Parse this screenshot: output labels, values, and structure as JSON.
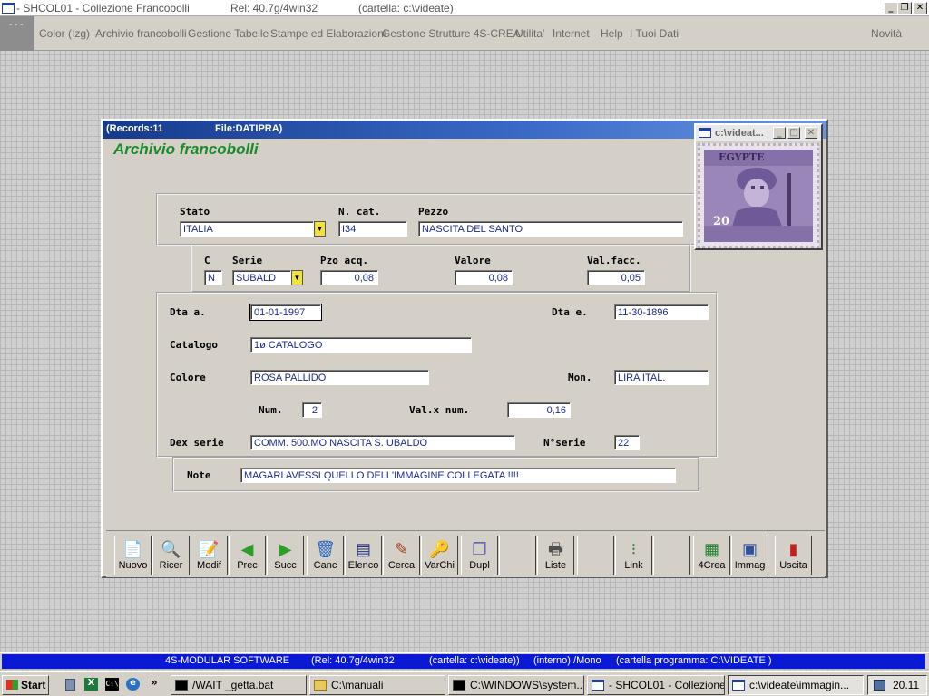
{
  "window": {
    "title": "- SHCOL01 - Collezione Francobolli",
    "rel": "Rel: 40.7g/4win32",
    "folder": "(cartella: c:\\videate)"
  },
  "menu": {
    "logo": "- - -",
    "items": [
      "Color (Izg)",
      "Archivio francobolli",
      "Gestione Tabelle",
      "Stampe ed Elaborazioni",
      "Gestione Strutture 4S-CREA",
      "Utilita'",
      "Internet",
      "Help",
      "I Tuoi Dati"
    ],
    "right": "Novità"
  },
  "form": {
    "records": "(Records:11",
    "file": "File:DATIPRA)",
    "app_title": "Archivio francobolli",
    "labels": {
      "stato": "Stato",
      "ncat": "N. cat.",
      "pezzo": "Pezzo",
      "c": "C",
      "serie": "Serie",
      "pzo_acq": "Pzo acq.",
      "valore": "Valore",
      "val_facc": "Val.facc.",
      "dta_a": "Dta a.",
      "dta_e": "Dta e.",
      "catalogo": "Catalogo",
      "colore": "Colore",
      "mon": "Mon.",
      "num": "Num.",
      "val_x_num": "Val.x num.",
      "dex_serie": "Dex serie",
      "n_serie": "N°serie",
      "note": "Note"
    },
    "values": {
      "stato": "ITALIA",
      "ncat": "I34",
      "pezzo": "NASCITA DEL SANTO",
      "c": "N",
      "serie": "SUBALD",
      "pzo_acq": "0,08",
      "valore": "0,08",
      "val_facc": "0,05",
      "dta_a": "01-01-1997",
      "dta_e": "11-30-1896",
      "catalogo": "1ø CATALOGO",
      "colore": "ROSA PALLIDO",
      "mon": "LIRA ITAL.",
      "num": "2",
      "val_x_num": "0,16",
      "dex_serie": "COMM. 500.MO NASCITA S. UBALDO",
      "n_serie": "22",
      "note": "MAGARI AVESSI QUELLO DELL'IMMAGINE COLLEGATA !!!!"
    }
  },
  "toolbar": {
    "buttons": [
      {
        "label": "Nuovo",
        "icon": "new-doc-icon",
        "glyph": "📄",
        "color": "#2a8a2a"
      },
      {
        "label": "Ricer",
        "icon": "magnifier-icon",
        "glyph": "🔍",
        "color": "#3050a0"
      },
      {
        "label": "Modif",
        "icon": "edit-doc-icon",
        "glyph": "📝",
        "color": "#3050a0"
      },
      {
        "label": "Prec",
        "icon": "arrow-left-icon",
        "glyph": "◀",
        "color": "#2aa02a"
      },
      {
        "label": "Succ",
        "icon": "arrow-right-icon",
        "glyph": "▶",
        "color": "#2aa02a"
      },
      {
        "label": "Canc",
        "icon": "trash-icon",
        "glyph": "🗑",
        "color": "#2060c0"
      },
      {
        "label": "Elenco",
        "icon": "list-icon",
        "glyph": "▤",
        "color": "#203080"
      },
      {
        "label": "Cerca",
        "icon": "find-icon",
        "glyph": "✎",
        "color": "#a04020"
      },
      {
        "label": "VarChi",
        "icon": "keys-icon",
        "glyph": "🔑",
        "color": "#a08020"
      },
      {
        "label": "Dupl",
        "icon": "duplicate-icon",
        "glyph": "❐",
        "color": "#6060c0"
      },
      {
        "label": "",
        "icon": "",
        "glyph": "",
        "color": ""
      },
      {
        "label": "Liste",
        "icon": "printer-icon",
        "glyph": "🖶",
        "color": "#505050"
      },
      {
        "label": "",
        "icon": "",
        "glyph": "",
        "color": ""
      },
      {
        "label": "Link",
        "icon": "link-tree-icon",
        "glyph": "⁝",
        "color": "#308030"
      },
      {
        "label": "",
        "icon": "",
        "glyph": "",
        "color": ""
      },
      {
        "label": "4Crea",
        "icon": "crea-icon",
        "glyph": "▦",
        "color": "#208030"
      },
      {
        "label": "Immag",
        "icon": "image-card-icon",
        "glyph": "▣",
        "color": "#3050a0"
      },
      {
        "label": "Uscita",
        "icon": "exit-door-icon",
        "glyph": "▮",
        "color": "#c02020"
      }
    ]
  },
  "stamp_window": {
    "title": "c:\\videat...",
    "stamp_text": "EGYPTE",
    "stamp_value": "20"
  },
  "statusbar": {
    "company": "4S-MODULAR SOFTWARE",
    "rel": "(Rel: 40.7g/4win32",
    "folder": "(cartella: c:\\videate))",
    "mode": "(interno)  /Mono",
    "program_folder": "(cartella programma: C:\\VIDEATE )"
  },
  "taskbar": {
    "start": "Start",
    "tasks": [
      {
        "label": "/WAIT _getta.bat",
        "icon": "cmd-icon"
      },
      {
        "label": "C:\\manuali",
        "icon": "folder-icon"
      },
      {
        "label": "C:\\WINDOWS\\system...",
        "icon": "cmd-icon"
      },
      {
        "label": "- SHCOL01 - Collezione...",
        "icon": "window-icon"
      },
      {
        "label": "c:\\videate\\immagin...",
        "icon": "window-icon"
      }
    ],
    "clock": "20.11"
  }
}
